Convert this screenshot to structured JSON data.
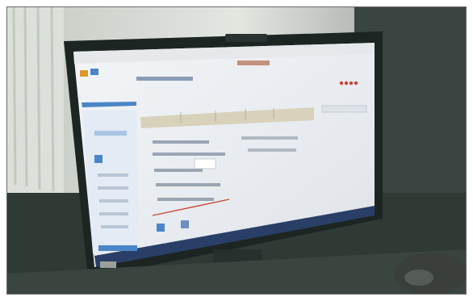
{
  "photo": {
    "colors": {
      "wall_light": "#c7cdc5",
      "curtain": "#dfe3dd",
      "room_dark": "#2f3a35",
      "bezel": "#1c2522",
      "desk": "#3a4540",
      "screen_white": "#eef0f4",
      "accent_blue": "#4a86c7",
      "taskbar": "#2a3f67",
      "tabs_header": "#d8d2bb",
      "red_dots": "#c84536",
      "hand": "#3a3f3c"
    },
    "screen": {
      "sidebar_items_count": 7,
      "form_rows_count": 6
    }
  }
}
